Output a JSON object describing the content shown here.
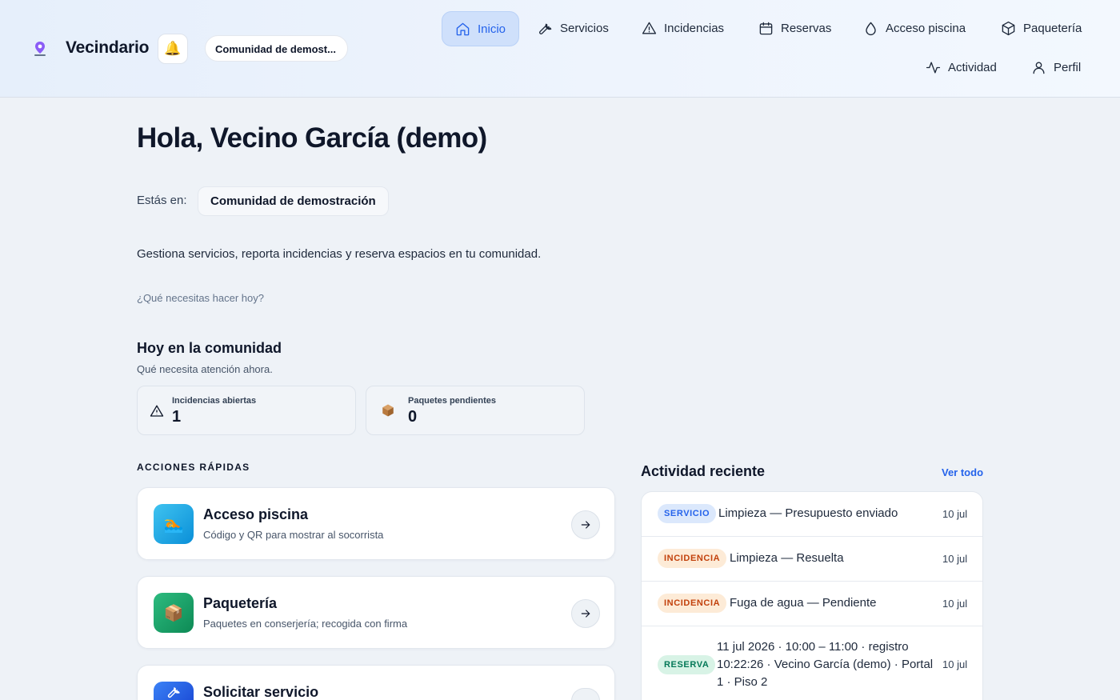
{
  "app": {
    "name": "Vecindario",
    "notifications_icon": "bell-icon",
    "community_short": "Comunidad de demost..."
  },
  "nav": [
    {
      "label": "Inicio",
      "icon": "home-icon",
      "active": true
    },
    {
      "label": "Servicios",
      "icon": "wrench-icon"
    },
    {
      "label": "Incidencias",
      "icon": "warning-icon"
    },
    {
      "label": "Reservas",
      "icon": "calendar-icon"
    },
    {
      "label": "Acceso piscina",
      "icon": "droplet-icon"
    },
    {
      "label": "Paquetería",
      "icon": "package-icon"
    },
    {
      "label": "Actividad",
      "icon": "activity-icon"
    },
    {
      "label": "Perfil",
      "icon": "user-icon"
    }
  ],
  "main": {
    "greeting": "Hola, Vecino García (demo)",
    "location_label": "Estás en:",
    "location_value": "Comunidad de demostración",
    "lead": "Gestiona servicios, reporta incidencias y reserva espacios en tu comunidad.",
    "question": "¿Qué necesitas hacer hoy?"
  },
  "today": {
    "title": "Hoy en la comunidad",
    "subtitle": "Qué necesita atención ahora.",
    "stats": [
      {
        "label": "Incidencias abiertas",
        "value": "1",
        "icon": "warning-icon"
      },
      {
        "label": "Paquetes pendientes",
        "value": "0",
        "icon": "package-icon"
      }
    ]
  },
  "quick_actions": {
    "title": "ACCIONES RÁPIDAS",
    "items": [
      {
        "name": "Acceso piscina",
        "description": "Código y QR para mostrar al socorrista",
        "icon": "swimmer-icon",
        "color": "#0a8fd8"
      },
      {
        "name": "Paquetería",
        "description": "Paquetes en conserjería; recogida con firma",
        "icon": "package-icon",
        "color": "#0d8a55"
      },
      {
        "name": "Solicitar servicio",
        "description": "",
        "icon": "wrench-icon",
        "color": "#1d4ed8"
      }
    ]
  },
  "activity": {
    "title": "Actividad reciente",
    "view_all": "Ver todo",
    "items": [
      {
        "badge": "SERVICIO",
        "text": "Limpieza — Presupuesto enviado",
        "date": "10 jul"
      },
      {
        "badge": "INCIDENCIA",
        "text": "Limpieza — Resuelta",
        "date": "10 jul"
      },
      {
        "badge": "INCIDENCIA",
        "text": "Fuga de agua — Pendiente",
        "date": "10 jul"
      },
      {
        "badge": "RESERVA",
        "text": "11 jul 2026 · 10:00 – 11:00 · registro 10:22:26 · Vecino García (demo) · Portal 1 · Piso 2",
        "date": "10 jul"
      }
    ]
  },
  "colors": {
    "accent": "#2563eb",
    "nav_active_bg": "#cfe0fb",
    "page_bg": "#eef2f7"
  }
}
